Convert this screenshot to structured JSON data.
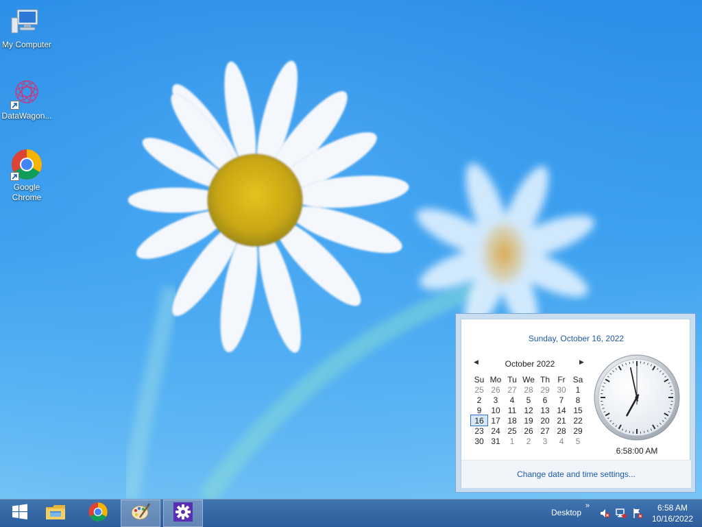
{
  "desktop": {
    "icons": [
      {
        "label": "My Computer",
        "icon": "computer-icon"
      },
      {
        "label": "DataWagon...",
        "icon": "datawagon-icon"
      },
      {
        "label": "Google Chrome",
        "icon": "chrome-icon"
      }
    ]
  },
  "flyout": {
    "long_date": "Sunday, October 16, 2022",
    "month_title": "October 2022",
    "prev_glyph": "◀",
    "next_glyph": "▶",
    "weekdays": [
      "Su",
      "Mo",
      "Tu",
      "We",
      "Th",
      "Fr",
      "Sa"
    ],
    "weeks": [
      [
        "25",
        "26",
        "27",
        "28",
        "29",
        "30",
        "1"
      ],
      [
        "2",
        "3",
        "4",
        "5",
        "6",
        "7",
        "8"
      ],
      [
        "9",
        "10",
        "11",
        "12",
        "13",
        "14",
        "15"
      ],
      [
        "16",
        "17",
        "18",
        "19",
        "20",
        "21",
        "22"
      ],
      [
        "23",
        "24",
        "25",
        "26",
        "27",
        "28",
        "29"
      ],
      [
        "30",
        "31",
        "1",
        "2",
        "3",
        "4",
        "5"
      ]
    ],
    "today": "16",
    "clock": {
      "hour": 6,
      "minute": 58,
      "second": 0
    },
    "digital_time": "6:58:00 AM",
    "settings_link": "Change date and time settings..."
  },
  "taskbar": {
    "buttons": [
      {
        "icon": "windows-start-icon",
        "active": false
      },
      {
        "icon": "file-explorer-icon",
        "active": false
      },
      {
        "icon": "chrome-icon",
        "active": false
      },
      {
        "icon": "paint-icon",
        "active": true
      },
      {
        "icon": "settings-gear-icon",
        "active": true
      }
    ],
    "desktop_label": "Desktop",
    "chevron": "»",
    "tray_icons": [
      "speaker-muted-icon",
      "network-icon",
      "action-center-flag-icon"
    ],
    "time": "6:58 AM",
    "date": "10/16/2022"
  }
}
